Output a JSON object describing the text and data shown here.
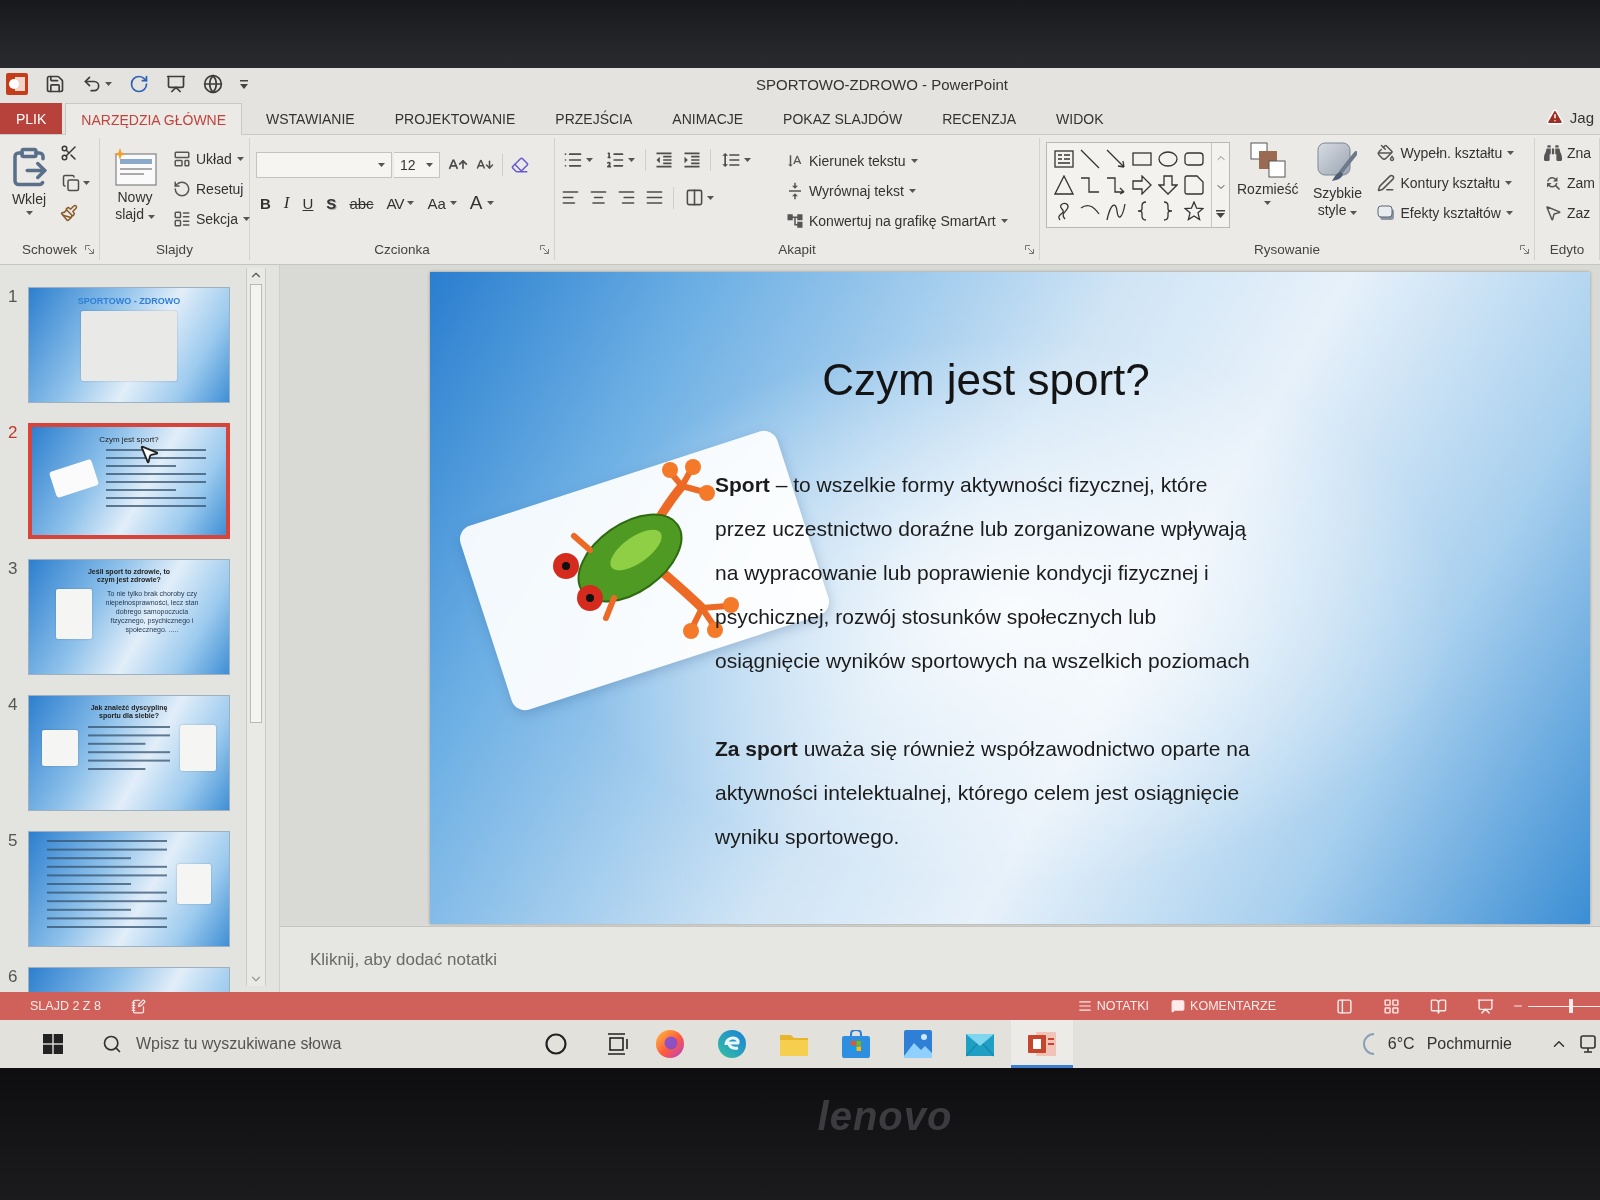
{
  "window": {
    "title": "SPORTOWO-ZDROWO - PowerPoint"
  },
  "tabs": [
    {
      "label": "PLIK",
      "kind": "file",
      "selected": false
    },
    {
      "label": "NARZĘDZIA GŁÓWNE",
      "kind": "tab",
      "selected": true
    },
    {
      "label": "WSTAWIANIE",
      "kind": "tab",
      "selected": false
    },
    {
      "label": "PROJEKTOWANIE",
      "kind": "tab",
      "selected": false
    },
    {
      "label": "PRZEJŚCIA",
      "kind": "tab",
      "selected": false
    },
    {
      "label": "ANIMACJE",
      "kind": "tab",
      "selected": false
    },
    {
      "label": "POKAZ SLAJDÓW",
      "kind": "tab",
      "selected": false
    },
    {
      "label": "RECENZJA",
      "kind": "tab",
      "selected": false
    },
    {
      "label": "WIDOK",
      "kind": "tab",
      "selected": false
    }
  ],
  "account": {
    "name": "Jag"
  },
  "ribbon": {
    "clipboard": {
      "label": "Schowek",
      "paste": "Wklej"
    },
    "slides": {
      "label": "Slajdy",
      "new_slide": "Nowy slajd",
      "commands": [
        {
          "label": "Układ",
          "kind": "layout",
          "dropdown": true
        },
        {
          "label": "Resetuj",
          "kind": "reset",
          "dropdown": false
        },
        {
          "label": "Sekcja",
          "kind": "section",
          "dropdown": true
        }
      ]
    },
    "font": {
      "label": "Czcionka",
      "size": "12",
      "formats": [
        {
          "label": "B",
          "kind": "bold",
          "dropdown": false
        },
        {
          "label": "I",
          "kind": "italic",
          "dropdown": false
        },
        {
          "label": "U",
          "kind": "underline",
          "dropdown": false
        },
        {
          "label": "S",
          "kind": "shadow",
          "dropdown": false
        },
        {
          "label": "abc",
          "kind": "strikethrough",
          "dropdown": false
        },
        {
          "label": "AV",
          "kind": "spacing",
          "dropdown": true
        },
        {
          "label": "Aa",
          "kind": "case",
          "dropdown": true
        },
        {
          "label": "A",
          "kind": "color",
          "dropdown": true
        }
      ]
    },
    "paragraph": {
      "label": "Akapit",
      "commands": [
        {
          "label": "Kierunek tekstu",
          "kind": "direction",
          "dropdown": true
        },
        {
          "label": "Wyrównaj tekst",
          "kind": "align",
          "dropdown": true
        },
        {
          "label": "Konwertuj na grafikę SmartArt",
          "kind": "smartart",
          "dropdown": true
        }
      ]
    },
    "drawing": {
      "label": "Rysowanie",
      "arrange": "Rozmieść",
      "quick_styles": "Szybkie style",
      "commands": [
        {
          "label": "Wypełn. kształtu",
          "kind": "fill",
          "dropdown": true
        },
        {
          "label": "Kontury kształtu",
          "kind": "outline",
          "dropdown": true
        },
        {
          "label": "Efekty kształtów",
          "kind": "effects",
          "dropdown": true
        }
      ]
    },
    "editing": {
      "label": "Edyto",
      "commands": [
        {
          "label": "Zna",
          "kind": "find"
        },
        {
          "label": "Zam",
          "kind": "replace"
        },
        {
          "label": "Zaz",
          "kind": "select"
        }
      ]
    }
  },
  "slide_panel": {
    "thumbnails": [
      {
        "number": "1",
        "kind": "title_collage",
        "selected": false,
        "title": "SPORTOWO - ZDROWO"
      },
      {
        "number": "2",
        "kind": "picture_text",
        "selected": true,
        "title": "Czym jest sport?"
      },
      {
        "number": "3",
        "kind": "picture_body",
        "selected": false,
        "title": "Jeśli sport to zdrowie, to czym jest zdrowie?",
        "body": "To nie tylko brak choroby czy niepełnosprawności, lecz stan dobrego samopoczucia fizycznego, psychicznego i społecznego. ....."
      },
      {
        "number": "4",
        "kind": "two_pictures",
        "selected": false,
        "title": "Jak znaleźć dyscyplinę sportu dla siebie?"
      },
      {
        "number": "5",
        "kind": "bullets_picture",
        "selected": false
      },
      {
        "number": "6",
        "kind": "partial",
        "selected": false
      }
    ]
  },
  "slide": {
    "title": "Czym jest sport?",
    "paragraphs": [
      {
        "lines": [
          "**Sport** – to wszelkie formy aktywności fizycznej, które",
          "przez uczestnictwo doraźne lub zorganizowane wpływają",
          "na wypracowanie lub poprawienie kondycji fizycznej i",
          "psychicznej, rozwój stosunków społecznych lub",
          "osiągnięcie wyników sportowych na wszelkich poziomach"
        ]
      },
      {
        "lines": [
          "**Za sport** uważa się również współzawodnictwo oparte na",
          "aktywności intelektualnej, którego celem jest osiągnięcie",
          "wyniku sportowego."
        ]
      }
    ]
  },
  "notes": {
    "placeholder": "Kliknij, aby dodać notatki"
  },
  "status_bar": {
    "slide_info": "SLAJD 2 Z 8",
    "notes": "NOTATKI",
    "comments": "KOMENTARZE",
    "zoom": {
      "level": 0.6
    }
  },
  "taskbar": {
    "search": {
      "placeholder": "Wpisz tu wyszukiwane słowa"
    },
    "apps": [
      {
        "kind": "browser",
        "active": false
      },
      {
        "kind": "edge",
        "active": false
      },
      {
        "kind": "folder",
        "active": false
      },
      {
        "kind": "store",
        "active": false
      },
      {
        "kind": "photos",
        "active": false
      },
      {
        "kind": "mail",
        "active": false
      },
      {
        "kind": "presentation",
        "active": true
      }
    ],
    "weather": {
      "temperature": "6°C",
      "condition": "Pochmurnie"
    }
  },
  "bezel": {
    "logo": "lenovo"
  }
}
